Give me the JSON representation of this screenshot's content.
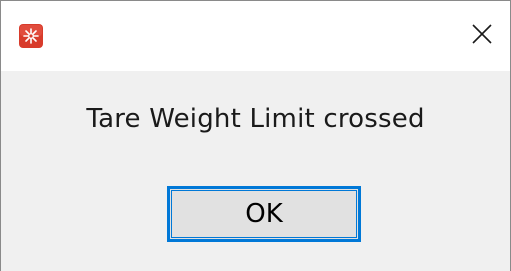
{
  "dialog": {
    "title": "",
    "message": "Tare Weight Limit crossed",
    "ok_label": "OK",
    "icons": {
      "app": "red-app-icon",
      "close": "close-icon"
    },
    "colors": {
      "titlebar": "#ffffff",
      "body": "#f0f0f0",
      "button_face": "#e1e1e1",
      "focus_border": "#0078d7",
      "app_icon": "#d83b2b"
    }
  }
}
